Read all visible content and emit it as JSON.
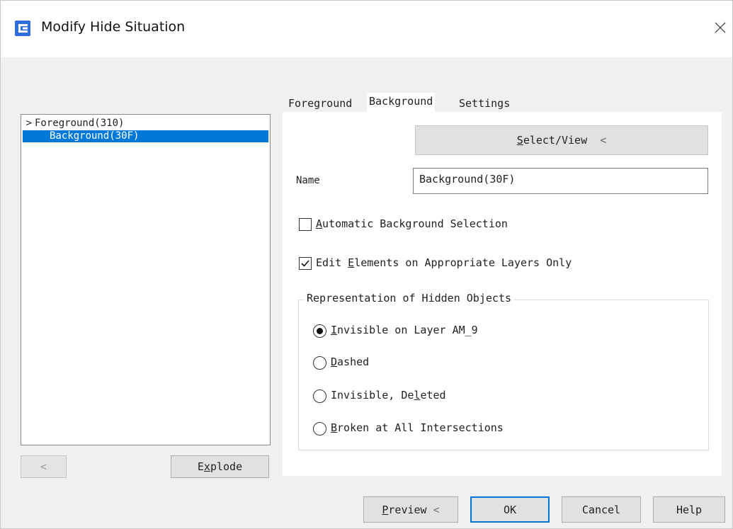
{
  "window": {
    "title": "Modify Hide Situation",
    "app_icon": "gstarcad-logo-icon",
    "close_icon": "close-icon",
    "accent_color": "#0078d7"
  },
  "tree": {
    "items": [
      {
        "prefix": ">",
        "label": "Foreground(310)",
        "selected": false
      },
      {
        "prefix": "",
        "label": "Background(30F)",
        "selected": true
      }
    ]
  },
  "left_buttons": {
    "back_label": "<",
    "explode_label": "Explode"
  },
  "tabs": [
    {
      "label": "Foreground",
      "active": false
    },
    {
      "label": "Background",
      "active": true
    },
    {
      "label": "Settings",
      "active": false
    }
  ],
  "select_view": {
    "label": "Select/View",
    "suffix": "<"
  },
  "name_field": {
    "label": "Name",
    "value": "Background(30F)"
  },
  "options": {
    "auto_bg": {
      "label": "Automatic Background Selection",
      "checked": false
    },
    "edit_layers": {
      "label": "Edit Elements on Appropriate Layers Only",
      "checked": true
    }
  },
  "representation": {
    "title": "Representation of Hidden Objects",
    "choices": [
      {
        "label": "Invisible on Layer AM_9",
        "checked": true
      },
      {
        "label": "Dashed",
        "checked": false
      },
      {
        "label": "Invisible, Deleted",
        "checked": false
      },
      {
        "label": "Broken at All Intersections",
        "checked": false
      }
    ]
  },
  "footer": {
    "preview_label": "Preview <",
    "ok_label": "OK",
    "cancel_label": "Cancel",
    "help_label": "Help"
  }
}
